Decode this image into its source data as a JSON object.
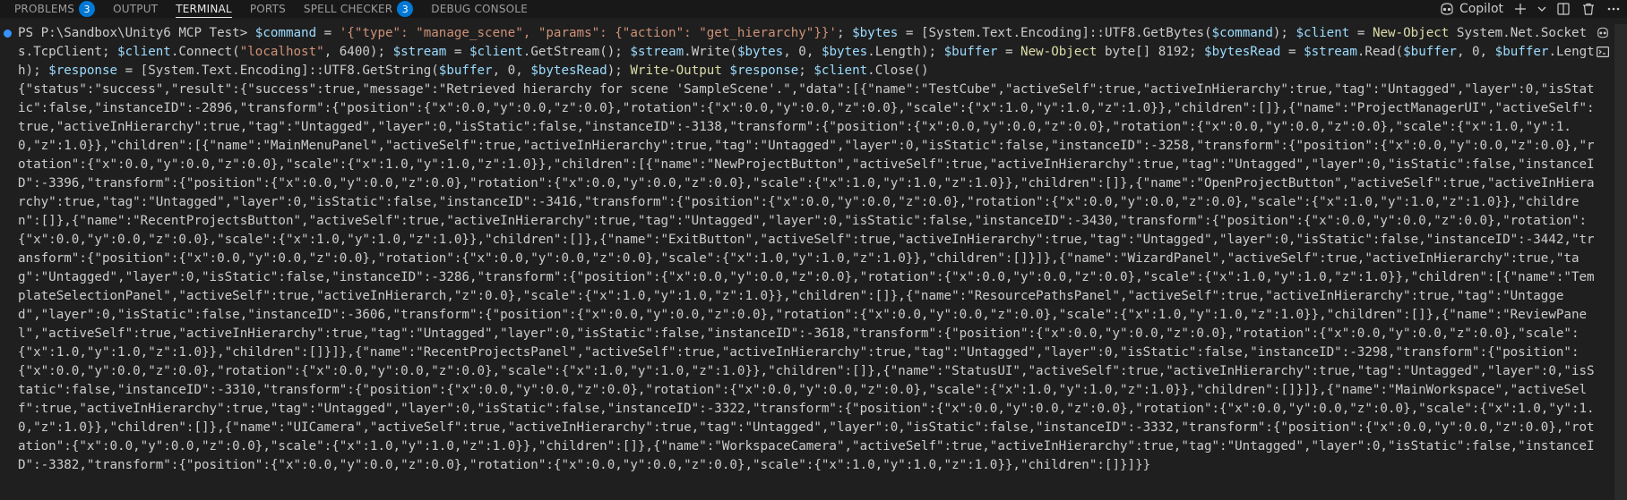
{
  "panel": {
    "tabs": [
      {
        "label": "PROBLEMS",
        "badge": "3"
      },
      {
        "label": "OUTPUT",
        "badge": ""
      },
      {
        "label": "TERMINAL",
        "badge": ""
      },
      {
        "label": "PORTS",
        "badge": ""
      },
      {
        "label": "SPELL CHECKER",
        "badge": "3"
      },
      {
        "label": "DEBUG CONSOLE",
        "badge": ""
      }
    ],
    "active_tab": "TERMINAL",
    "copilot_label": "Copilot",
    "icons": {
      "copilot": "copilot-icon",
      "new_terminal": "plus-icon",
      "dropdown": "chevron-down-icon",
      "split": "split-terminal-icon",
      "kill": "trash-icon",
      "more": "ellipsis-icon"
    }
  },
  "terminal": {
    "prompt": "PS P:\\Sandbox\\Unity6 MCP Test> ",
    "command_parts": [
      {
        "t": "var",
        "v": "$command"
      },
      {
        "t": "plain",
        "v": " = "
      },
      {
        "t": "str",
        "v": "'{\"type\": \"manage_scene\", \"params\": {\"action\": \"get_hierarchy\"}}'"
      },
      {
        "t": "plain",
        "v": "; "
      },
      {
        "t": "var",
        "v": "$bytes"
      },
      {
        "t": "plain",
        "v": " = [System.Text.Encoding]::UTF8.GetBytes("
      },
      {
        "t": "var",
        "v": "$command"
      },
      {
        "t": "plain",
        "v": "); "
      },
      {
        "t": "var",
        "v": "$client"
      },
      {
        "t": "plain",
        "v": " = "
      },
      {
        "t": "cmdlet",
        "v": "New-Object"
      },
      {
        "t": "plain",
        "v": " System.Net.Sockets.TcpClient; "
      },
      {
        "t": "var",
        "v": "$client"
      },
      {
        "t": "plain",
        "v": ".Connect("
      },
      {
        "t": "str",
        "v": "\"localhost\""
      },
      {
        "t": "plain",
        "v": ", 6400); "
      },
      {
        "t": "var",
        "v": "$stream"
      },
      {
        "t": "plain",
        "v": " = "
      },
      {
        "t": "var",
        "v": "$client"
      },
      {
        "t": "plain",
        "v": ".GetStream(); "
      },
      {
        "t": "var",
        "v": "$stream"
      },
      {
        "t": "plain",
        "v": ".Write("
      },
      {
        "t": "var",
        "v": "$bytes"
      },
      {
        "t": "plain",
        "v": ", 0, "
      },
      {
        "t": "var",
        "v": "$bytes"
      },
      {
        "t": "plain",
        "v": ".Length); "
      },
      {
        "t": "var",
        "v": "$buffer"
      },
      {
        "t": "plain",
        "v": " = "
      },
      {
        "t": "cmdlet",
        "v": "New-Object"
      },
      {
        "t": "plain",
        "v": " byte[] 8192; "
      },
      {
        "t": "var",
        "v": "$bytesRead"
      },
      {
        "t": "plain",
        "v": " = "
      },
      {
        "t": "var",
        "v": "$stream"
      },
      {
        "t": "plain",
        "v": ".Read("
      },
      {
        "t": "var",
        "v": "$buffer"
      },
      {
        "t": "plain",
        "v": ", 0, "
      },
      {
        "t": "var",
        "v": "$buffer"
      },
      {
        "t": "plain",
        "v": ".Length); "
      },
      {
        "t": "var",
        "v": "$response"
      },
      {
        "t": "plain",
        "v": " = [System.Text.Encoding]::UTF8.GetString("
      },
      {
        "t": "var",
        "v": "$buffer"
      },
      {
        "t": "plain",
        "v": ", 0, "
      },
      {
        "t": "var",
        "v": "$bytesRead"
      },
      {
        "t": "plain",
        "v": "); "
      },
      {
        "t": "cmdlet",
        "v": "Write-Output"
      },
      {
        "t": "plain",
        "v": " "
      },
      {
        "t": "var",
        "v": "$response"
      },
      {
        "t": "plain",
        "v": "; "
      },
      {
        "t": "var",
        "v": "$client"
      },
      {
        "t": "plain",
        "v": ".Close()"
      }
    ],
    "output": "{\"status\":\"success\",\"result\":{\"success\":true,\"message\":\"Retrieved hierarchy for scene 'SampleScene'.\",\"data\":[{\"name\":\"TestCube\",\"activeSelf\":true,\"activeInHierarchy\":true,\"tag\":\"Untagged\",\"layer\":0,\"isStatic\":false,\"instanceID\":-2896,\"transform\":{\"position\":{\"x\":0.0,\"y\":0.0,\"z\":0.0},\"rotation\":{\"x\":0.0,\"y\":0.0,\"z\":0.0},\"scale\":{\"x\":1.0,\"y\":1.0,\"z\":1.0}},\"children\":[]},{\"name\":\"ProjectManagerUI\",\"activeSelf\":true,\"activeInHierarchy\":true,\"tag\":\"Untagged\",\"layer\":0,\"isStatic\":false,\"instanceID\":-3138,\"transform\":{\"position\":{\"x\":0.0,\"y\":0.0,\"z\":0.0},\"rotation\":{\"x\":0.0,\"y\":0.0,\"z\":0.0},\"scale\":{\"x\":1.0,\"y\":1.0,\"z\":1.0}},\"children\":[{\"name\":\"MainMenuPanel\",\"activeSelf\":true,\"activeInHierarchy\":true,\"tag\":\"Untagged\",\"layer\":0,\"isStatic\":false,\"instanceID\":-3258,\"transform\":{\"position\":{\"x\":0.0,\"y\":0.0,\"z\":0.0},\"rotation\":{\"x\":0.0,\"y\":0.0,\"z\":0.0},\"scale\":{\"x\":1.0,\"y\":1.0,\"z\":1.0}},\"children\":[{\"name\":\"NewProjectButton\",\"activeSelf\":true,\"activeInHierarchy\":true,\"tag\":\"Untagged\",\"layer\":0,\"isStatic\":false,\"instanceID\":-3396,\"transform\":{\"position\":{\"x\":0.0,\"y\":0.0,\"z\":0.0},\"rotation\":{\"x\":0.0,\"y\":0.0,\"z\":0.0},\"scale\":{\"x\":1.0,\"y\":1.0,\"z\":1.0}},\"children\":[]},{\"name\":\"OpenProjectButton\",\"activeSelf\":true,\"activeInHierarchy\":true,\"tag\":\"Untagged\",\"layer\":0,\"isStatic\":false,\"instanceID\":-3416,\"transform\":{\"position\":{\"x\":0.0,\"y\":0.0,\"z\":0.0},\"rotation\":{\"x\":0.0,\"y\":0.0,\"z\":0.0},\"scale\":{\"x\":1.0,\"y\":1.0,\"z\":1.0}},\"children\":[]},{\"name\":\"RecentProjectsButton\",\"activeSelf\":true,\"activeInHierarchy\":true,\"tag\":\"Untagged\",\"layer\":0,\"isStatic\":false,\"instanceID\":-3430,\"transform\":{\"position\":{\"x\":0.0,\"y\":0.0,\"z\":0.0},\"rotation\":{\"x\":0.0,\"y\":0.0,\"z\":0.0},\"scale\":{\"x\":1.0,\"y\":1.0,\"z\":1.0}},\"children\":[]},{\"name\":\"ExitButton\",\"activeSelf\":true,\"activeInHierarchy\":true,\"tag\":\"Untagged\",\"layer\":0,\"isStatic\":false,\"instanceID\":-3442,\"transform\":{\"position\":{\"x\":0.0,\"y\":0.0,\"z\":0.0},\"rotation\":{\"x\":0.0,\"y\":0.0,\"z\":0.0},\"scale\":{\"x\":1.0,\"y\":1.0,\"z\":1.0}},\"children\":[]}]},{\"name\":\"WizardPanel\",\"activeSelf\":true,\"activeInHierarchy\":true,\"tag\":\"Untagged\",\"layer\":0,\"isStatic\":false,\"instanceID\":-3286,\"transform\":{\"position\":{\"x\":0.0,\"y\":0.0,\"z\":0.0},\"rotation\":{\"x\":0.0,\"y\":0.0,\"z\":0.0},\"scale\":{\"x\":1.0,\"y\":1.0,\"z\":1.0}},\"children\":[{\"name\":\"TemplateSelectionPanel\",\"activeSelf\":true,\"activeInHierarch,\"z\":0.0},\"scale\":{\"x\":1.0,\"y\":1.0,\"z\":1.0}},\"children\":[]},{\"name\":\"ResourcePathsPanel\",\"activeSelf\":true,\"activeInHierarchy\":true,\"tag\":\"Untagged\",\"layer\":0,\"isStatic\":false,\"instanceID\":-3606,\"transform\":{\"position\":{\"x\":0.0,\"y\":0.0,\"z\":0.0},\"rotation\":{\"x\":0.0,\"y\":0.0,\"z\":0.0},\"scale\":{\"x\":1.0,\"y\":1.0,\"z\":1.0}},\"children\":[]},{\"name\":\"ReviewPanel\",\"activeSelf\":true,\"activeInHierarchy\":true,\"tag\":\"Untagged\",\"layer\":0,\"isStatic\":false,\"instanceID\":-3618,\"transform\":{\"position\":{\"x\":0.0,\"y\":0.0,\"z\":0.0},\"rotation\":{\"x\":0.0,\"y\":0.0,\"z\":0.0},\"scale\":{\"x\":1.0,\"y\":1.0,\"z\":1.0}},\"children\":[]}]},{\"name\":\"RecentProjectsPanel\",\"activeSelf\":true,\"activeInHierarchy\":true,\"tag\":\"Untagged\",\"layer\":0,\"isStatic\":false,\"instanceID\":-3298,\"transform\":{\"position\":{\"x\":0.0,\"y\":0.0,\"z\":0.0},\"rotation\":{\"x\":0.0,\"y\":0.0,\"z\":0.0},\"scale\":{\"x\":1.0,\"y\":1.0,\"z\":1.0}},\"children\":[]},{\"name\":\"StatusUI\",\"activeSelf\":true,\"activeInHierarchy\":true,\"tag\":\"Untagged\",\"layer\":0,\"isStatic\":false,\"instanceID\":-3310,\"transform\":{\"position\":{\"x\":0.0,\"y\":0.0,\"z\":0.0},\"rotation\":{\"x\":0.0,\"y\":0.0,\"z\":0.0},\"scale\":{\"x\":1.0,\"y\":1.0,\"z\":1.0}},\"children\":[]}]},{\"name\":\"MainWorkspace\",\"activeSelf\":true,\"activeInHierarchy\":true,\"tag\":\"Untagged\",\"layer\":0,\"isStatic\":false,\"instanceID\":-3322,\"transform\":{\"position\":{\"x\":0.0,\"y\":0.0,\"z\":0.0},\"rotation\":{\"x\":0.0,\"y\":0.0,\"z\":0.0},\"scale\":{\"x\":1.0,\"y\":1.0,\"z\":1.0}},\"children\":[]},{\"name\":\"UICamera\",\"activeSelf\":true,\"activeInHierarchy\":true,\"tag\":\"Untagged\",\"layer\":0,\"isStatic\":false,\"instanceID\":-3332,\"transform\":{\"position\":{\"x\":0.0,\"y\":0.0,\"z\":0.0},\"rotation\":{\"x\":0.0,\"y\":0.0,\"z\":0.0},\"scale\":{\"x\":1.0,\"y\":1.0,\"z\":1.0}},\"children\":[]},{\"name\":\"WorkspaceCamera\",\"activeSelf\":true,\"activeInHierarchy\":true,\"tag\":\"Untagged\",\"layer\":0,\"isStatic\":false,\"instanceID\":-3382,\"transform\":{\"position\":{\"x\":0.0,\"y\":0.0,\"z\":0.0},\"rotation\":{\"x\":0.0,\"y\":0.0,\"z\":0.0},\"scale\":{\"x\":1.0,\"y\":1.0,\"z\":1.0}},\"children\":[]}]}}"
  }
}
